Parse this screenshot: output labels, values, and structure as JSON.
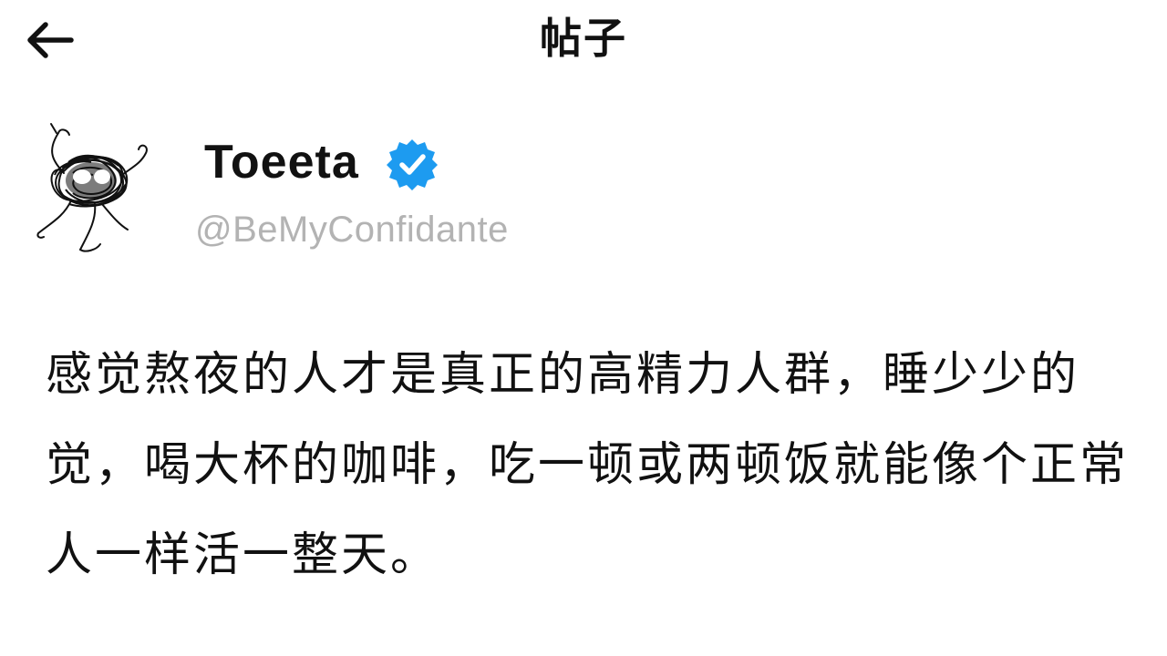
{
  "header": {
    "title": "帖子",
    "back_icon": "arrow-left-icon"
  },
  "author": {
    "display_name": "Toeeta",
    "handle": "@BeMyConfidante",
    "verified": true,
    "badge_color": "#1d9bf0",
    "avatar_icon": "scribble-avatar"
  },
  "post": {
    "text": "感觉熬夜的人才是真正的高精力人群，睡少少的觉，喝大杯的咖啡，吃一顿或两顿饭就能像个正常人一样活一整天。"
  }
}
